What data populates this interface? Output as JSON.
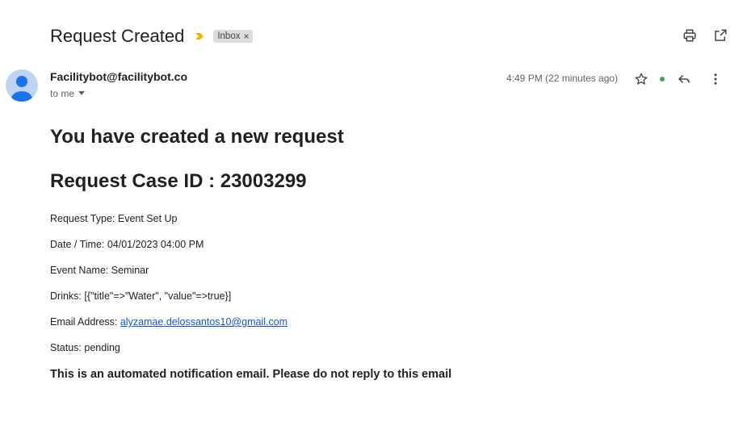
{
  "email": {
    "subject": "Request Created",
    "label": "Inbox",
    "label_close": "×",
    "sender": "Facilitybot@facilitybot.co",
    "recipient": "to me",
    "time": "4:49 PM (22 minutes ago)"
  },
  "content": {
    "heading": "You have created a new request",
    "case_id_heading": "Request Case ID : 23003299",
    "request_type": "Request Type: Event Set Up",
    "date_time": "Date / Time: 04/01/2023 04:00 PM",
    "event_name": "Event Name: Seminar",
    "drinks": "Drinks: [{\"title\"=>\"Water\", \"value\"=>true}]",
    "email_label": "Email Address: ",
    "email_address": "alyzamae.delossantos10@gmail.com",
    "status": "Status: pending",
    "footer": "This is an automated notification email. Please do not reply to this email"
  },
  "icons": {
    "importance": "importance-marker-icon",
    "print": "print-icon",
    "open_new_window": "open-in-new-window-icon",
    "star": "star-icon",
    "reply": "reply-icon",
    "more": "more-vertical-icon",
    "avatar": "default-avatar-icon"
  },
  "colors": {
    "importance": "#f4b400",
    "link": "#1155cc",
    "online_dot": "#34a853",
    "avatar_bg": "#bfd4f5",
    "avatar_fg": "#1a73e8"
  }
}
